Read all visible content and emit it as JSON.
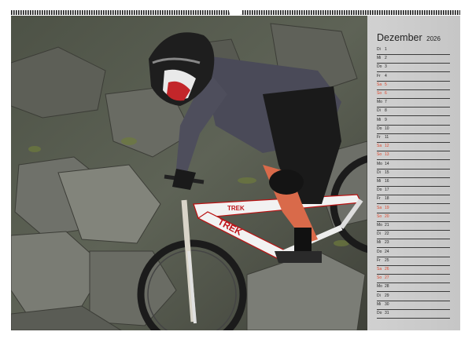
{
  "calendar": {
    "month": "Dezember",
    "year": "2026",
    "days": [
      {
        "wd": "Di",
        "d": "1"
      },
      {
        "wd": "Mi",
        "d": "2"
      },
      {
        "wd": "Do",
        "d": "3"
      },
      {
        "wd": "Fr",
        "d": "4"
      },
      {
        "wd": "Sa",
        "d": "5"
      },
      {
        "wd": "So",
        "d": "6"
      },
      {
        "wd": "Mo",
        "d": "7"
      },
      {
        "wd": "Di",
        "d": "8"
      },
      {
        "wd": "Mi",
        "d": "9"
      },
      {
        "wd": "Do",
        "d": "10"
      },
      {
        "wd": "Fr",
        "d": "11"
      },
      {
        "wd": "Sa",
        "d": "12"
      },
      {
        "wd": "So",
        "d": "13"
      },
      {
        "wd": "Mo",
        "d": "14"
      },
      {
        "wd": "Di",
        "d": "15"
      },
      {
        "wd": "Mi",
        "d": "16"
      },
      {
        "wd": "Do",
        "d": "17"
      },
      {
        "wd": "Fr",
        "d": "18"
      },
      {
        "wd": "Sa",
        "d": "19"
      },
      {
        "wd": "So",
        "d": "20"
      },
      {
        "wd": "Mo",
        "d": "21"
      },
      {
        "wd": "Di",
        "d": "22"
      },
      {
        "wd": "Mi",
        "d": "23"
      },
      {
        "wd": "Do",
        "d": "24"
      },
      {
        "wd": "Fr",
        "d": "25"
      },
      {
        "wd": "Sa",
        "d": "26"
      },
      {
        "wd": "So",
        "d": "27"
      },
      {
        "wd": "Mo",
        "d": "28"
      },
      {
        "wd": "Di",
        "d": "29"
      },
      {
        "wd": "Mi",
        "d": "30"
      },
      {
        "wd": "Do",
        "d": "31"
      }
    ]
  },
  "photo": {
    "frame_brand": "TREK"
  },
  "colors": {
    "sunday": "#e0452a",
    "panel": "#c8c8c8",
    "spiral": "#1a1a1a"
  }
}
